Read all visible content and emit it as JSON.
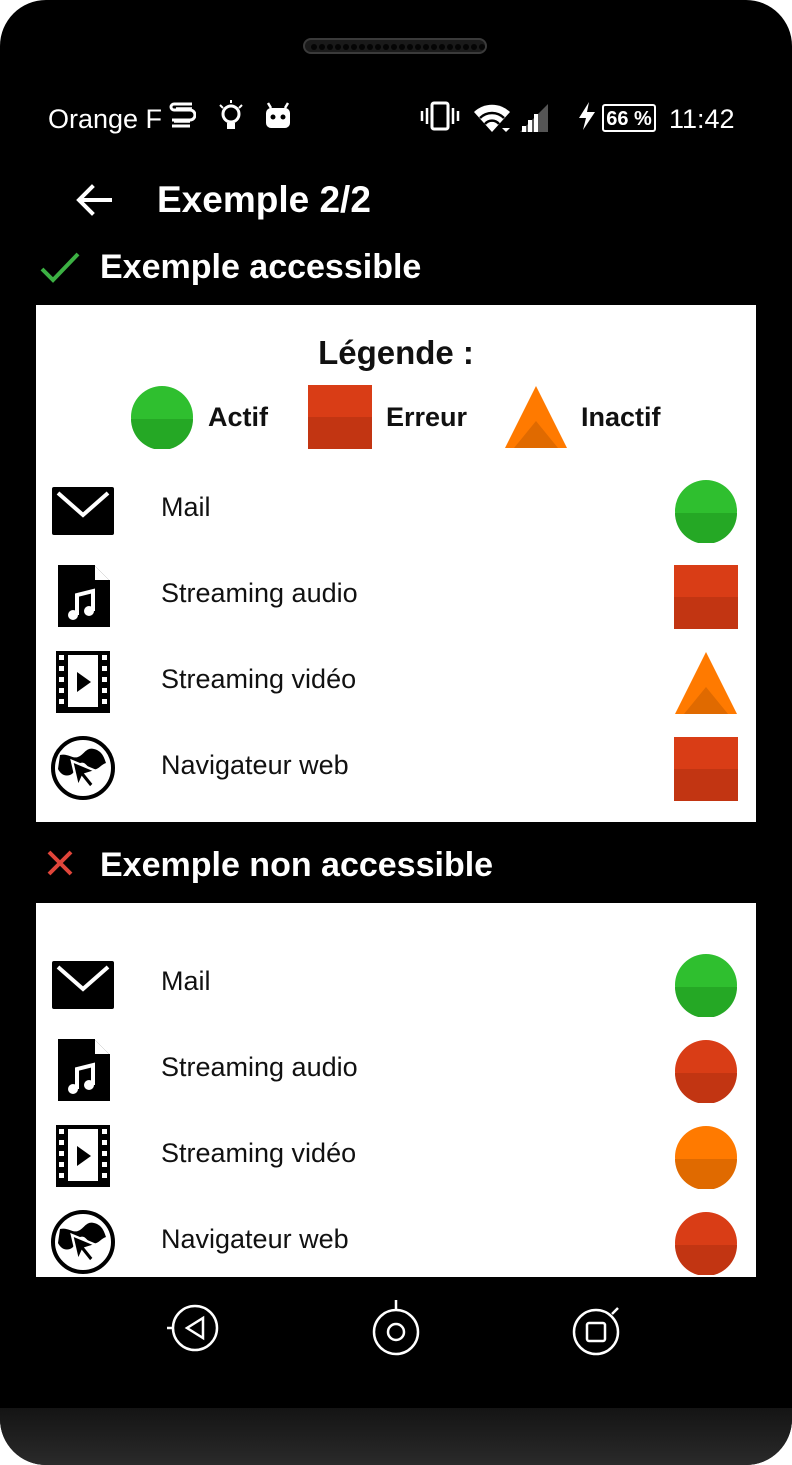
{
  "status_bar": {
    "carrier": "Orange F",
    "battery": "66 %",
    "time": "11:42"
  },
  "app_bar": {
    "title": "Exemple 2/2"
  },
  "accessible_section": {
    "title": "Exemple accessible",
    "legend_title": "Légende :",
    "legend": [
      {
        "label": "Actif",
        "shape": "circle",
        "color": "#2fbf2f"
      },
      {
        "label": "Erreur",
        "shape": "square",
        "color": "#d93d16"
      },
      {
        "label": "Inactif",
        "shape": "triangle",
        "color": "#ff7a00"
      }
    ],
    "rows": [
      {
        "label": "Mail",
        "icon": "mail-icon",
        "status": "circle",
        "color": "#2fbf2f"
      },
      {
        "label": "Streaming audio",
        "icon": "music-file-icon",
        "status": "square",
        "color": "#d93d16"
      },
      {
        "label": "Streaming vidéo",
        "icon": "video-file-icon",
        "status": "triangle",
        "color": "#ff7a00"
      },
      {
        "label": "Navigateur web",
        "icon": "web-globe-icon",
        "status": "square",
        "color": "#d93d16"
      }
    ]
  },
  "non_accessible_section": {
    "title": "Exemple non accessible",
    "rows": [
      {
        "label": "Mail",
        "icon": "mail-icon",
        "status": "circle",
        "color": "#2fbf2f"
      },
      {
        "label": "Streaming audio",
        "icon": "music-file-icon",
        "status": "circle",
        "color": "#d93d16"
      },
      {
        "label": "Streaming vidéo",
        "icon": "video-file-icon",
        "status": "circle",
        "color": "#ff7a00"
      },
      {
        "label": "Navigateur web",
        "icon": "web-globe-icon",
        "status": "circle",
        "color": "#d93d16"
      }
    ]
  },
  "colors": {
    "check": "#3cb043",
    "cross": "#e0453a"
  }
}
